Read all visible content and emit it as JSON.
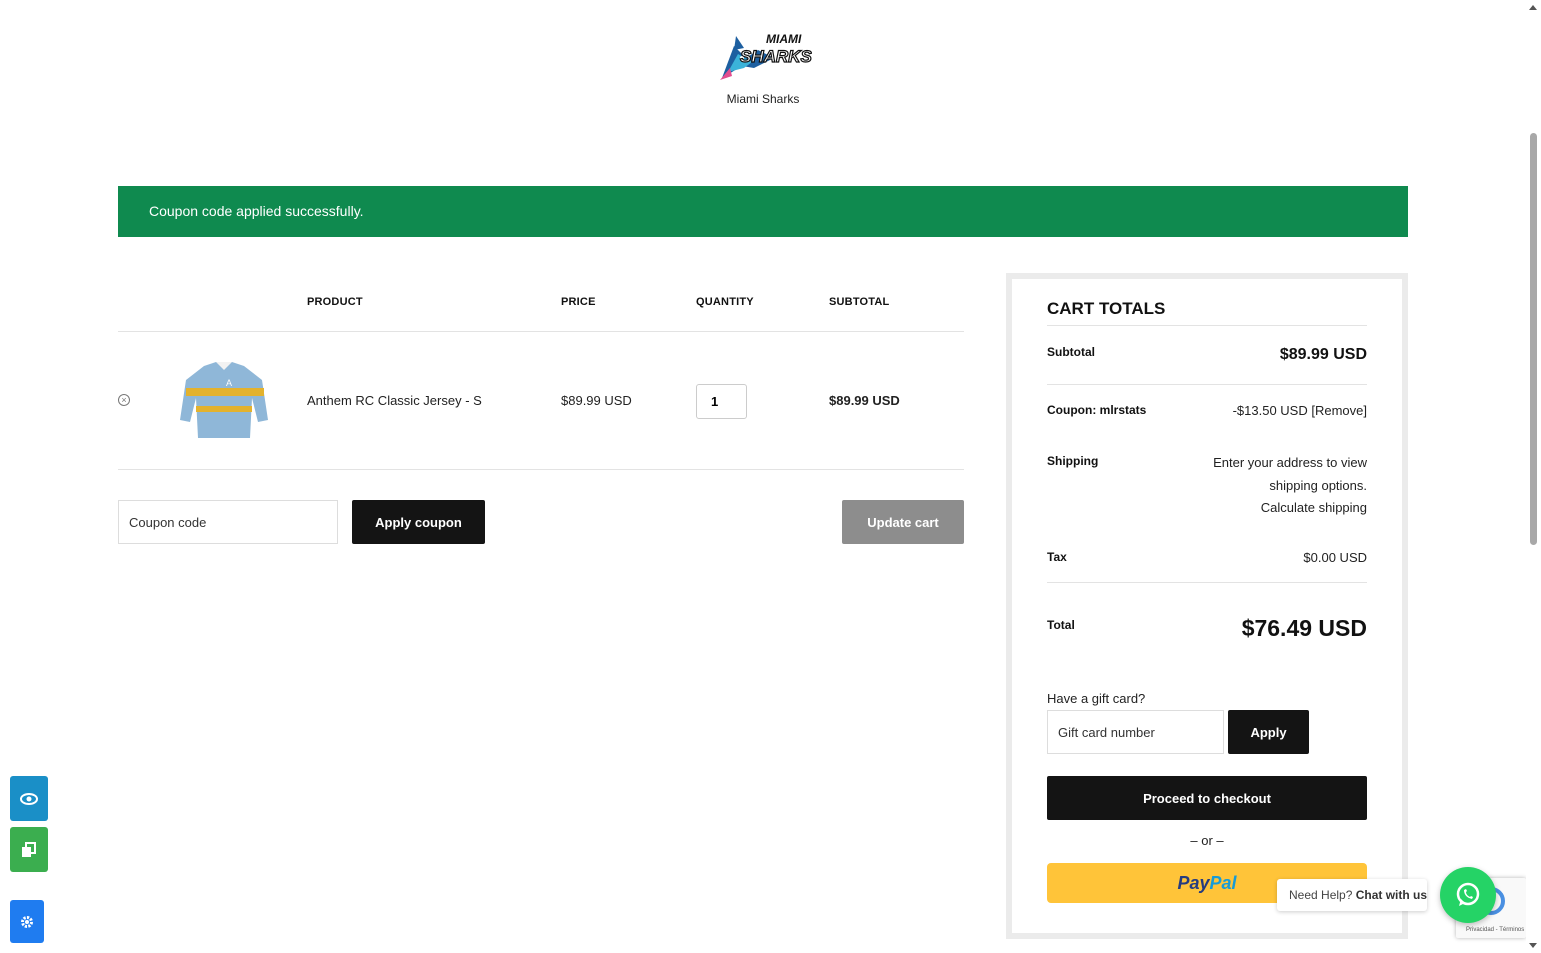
{
  "brand": {
    "name": "Miami Sharks",
    "logo_word_top": "MIAMI",
    "logo_word_bottom": "SHARKS"
  },
  "notice": {
    "message": "Coupon code applied successfully."
  },
  "cart": {
    "headers": {
      "product": "PRODUCT",
      "price": "PRICE",
      "quantity": "QUANTITY",
      "subtotal": "SUBTOTAL"
    },
    "items": [
      {
        "name": "Anthem RC Classic Jersey - S",
        "price": "$89.99 USD",
        "quantity": "1",
        "subtotal": "$89.99 USD",
        "remove_icon": "close-circle-icon"
      }
    ],
    "coupon_placeholder": "Coupon code",
    "apply_coupon_label": "Apply coupon",
    "update_cart_label": "Update cart"
  },
  "totals": {
    "title": "CART TOTALS",
    "subtotal_label": "Subtotal",
    "subtotal_value": "$89.99 USD",
    "coupon_label": "Coupon: mlrstats",
    "coupon_value": "-$13.50 USD [Remove]",
    "shipping_label": "Shipping",
    "shipping_line1": "Enter your address to view",
    "shipping_line2": "shipping options.",
    "shipping_link": "Calculate shipping",
    "tax_label": "Tax",
    "tax_value": "$0.00 USD",
    "total_label": "Total",
    "total_value": "$76.49 USD",
    "gift_label": "Have a gift card?",
    "gift_placeholder": "Gift card number",
    "gift_apply_label": "Apply",
    "checkout_label": "Proceed to checkout",
    "or_text": "– or –",
    "paypal_part1": "Pay",
    "paypal_part2": "Pal"
  },
  "widgets": {
    "whatsapp_text": "Need Help?",
    "whatsapp_bold": "Chat with us",
    "recaptcha_text": "Privacidad - Términos"
  },
  "colors": {
    "notice_bg": "#0f8a4f",
    "primary_dark": "#141414",
    "paypal_yellow": "#ffc439",
    "whatsapp_green": "#25d366"
  }
}
